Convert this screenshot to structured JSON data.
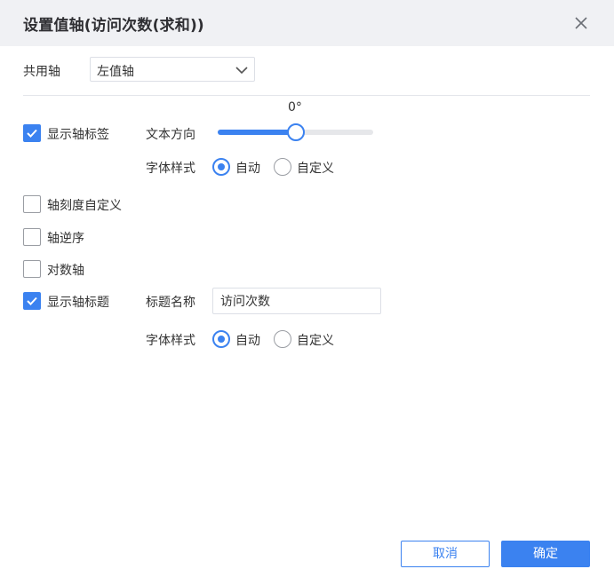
{
  "dialog": {
    "title": "设置值轴(访问次数(求和))"
  },
  "shared_axis": {
    "label": "共用轴",
    "selected": "左值轴"
  },
  "axis_label": {
    "checkbox_label": "显示轴标签",
    "checked": true,
    "text_direction_label": "文本方向",
    "rotation_value": "0°",
    "rotation_degrees": 0,
    "font_style_label": "字体样式",
    "font_style_options": [
      "自动",
      "自定义"
    ],
    "font_style_selected": "自动"
  },
  "options": {
    "custom_scale_label": "轴刻度自定义",
    "custom_scale_checked": false,
    "reverse_label": "轴逆序",
    "reverse_checked": false,
    "log_axis_label": "对数轴",
    "log_axis_checked": false
  },
  "axis_title": {
    "checkbox_label": "显示轴标题",
    "checked": true,
    "title_name_label": "标题名称",
    "title_name_value": "访问次数",
    "font_style_label": "字体样式",
    "font_style_options": [
      "自动",
      "自定义"
    ],
    "font_style_selected": "自动"
  },
  "footer": {
    "cancel_label": "取消",
    "ok_label": "确定"
  },
  "colors": {
    "accent": "#3b82f0",
    "header_bg": "#f0f1f4"
  }
}
